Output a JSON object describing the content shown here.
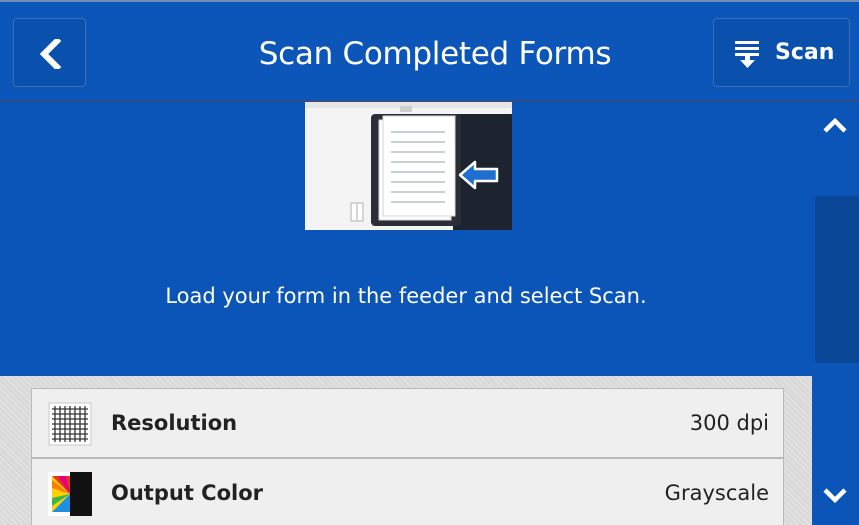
{
  "header": {
    "title": "Scan Completed Forms",
    "back_icon": "chevron-left-icon",
    "scan_button": {
      "label": "Scan",
      "icon": "scan-icon"
    }
  },
  "main": {
    "illustration_icon": "document-feeder-icon",
    "instruction": "Load your form in the feeder and select Scan."
  },
  "settings": [
    {
      "label": "Resolution",
      "value": "300 dpi",
      "icon": "resolution-grid-icon"
    },
    {
      "label": "Output Color",
      "value": "Grayscale",
      "icon": "output-color-icon"
    }
  ],
  "scrollbar": {
    "up_icon": "chevron-up-icon",
    "down_icon": "chevron-down-icon"
  },
  "colors": {
    "primary_blue": "#0a55b7",
    "text_white": "#ffffff",
    "list_background": "#efefef"
  }
}
